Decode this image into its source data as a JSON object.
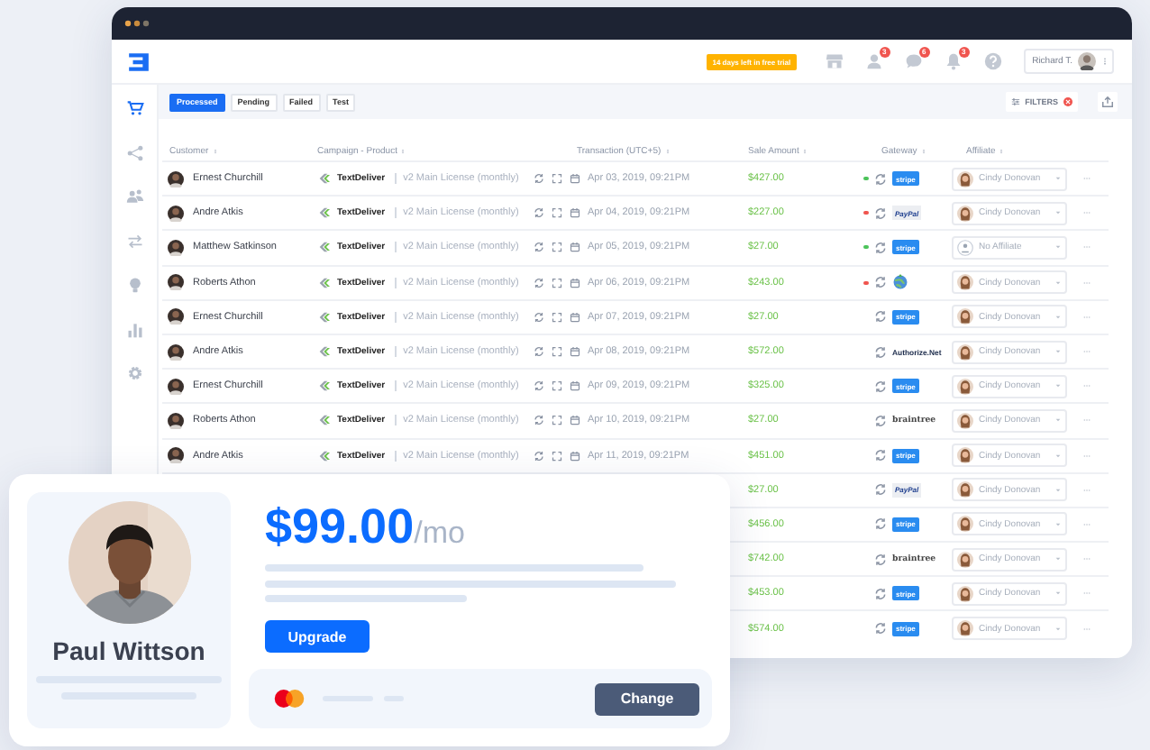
{
  "header": {
    "trial_badge": "14 days left in free trial",
    "icons": [
      {
        "kind": "store"
      },
      {
        "kind": "user",
        "count": "3"
      },
      {
        "kind": "chat",
        "count": "6"
      },
      {
        "kind": "bell",
        "count": "3"
      },
      {
        "kind": "help"
      }
    ],
    "user_name": "Richard T."
  },
  "sidebar": {
    "items": [
      {
        "kind": "cart",
        "selected": true
      },
      {
        "kind": "network",
        "selected": false
      },
      {
        "kind": "users",
        "selected": false
      },
      {
        "kind": "transfer",
        "selected": false
      },
      {
        "kind": "bulb",
        "selected": false
      },
      {
        "kind": "chart",
        "selected": false
      },
      {
        "kind": "settings",
        "selected": false
      }
    ]
  },
  "tabs": [
    {
      "label": "Processed",
      "selected": true
    },
    {
      "label": "Pending",
      "selected": false
    },
    {
      "label": "Failed",
      "selected": false
    },
    {
      "label": "Test",
      "selected": false
    }
  ],
  "filters": {
    "label": "FILTERS"
  },
  "table": {
    "columns": [
      "Customer",
      "Campaign - Product",
      "Transaction (UTC+5)",
      "Sale Amount",
      "Gateway",
      "Affiliate"
    ],
    "rows": [
      {
        "customer": "Ernest Churchill",
        "campaign": "TextDeliver",
        "product": "v2 Main License (monthly)",
        "date": "Apr 03, 2019, 09:21PM",
        "amount": "$427.00",
        "color": "#4cc35a",
        "gateway": {
          "kind": "stripe",
          "label": "stripe"
        },
        "affiliate": {
          "kind": "person",
          "name": "Cindy Donovan"
        }
      },
      {
        "customer": "Andre Atkis",
        "campaign": "TextDeliver",
        "product": "v2 Main License (monthly)",
        "date": "Apr 04, 2019, 09:21PM",
        "amount": "$227.00",
        "color": "#f0554f",
        "gateway": {
          "kind": "paypal",
          "label": "PayPal"
        },
        "affiliate": {
          "kind": "person",
          "name": "Cindy Donovan"
        }
      },
      {
        "customer": "Matthew Satkinson",
        "campaign": "TextDeliver",
        "product": "v2 Main License (monthly)",
        "date": "Apr 05, 2019, 09:21PM",
        "amount": "$27.00",
        "color": "#4cc35a",
        "gateway": {
          "kind": "stripe",
          "label": "stripe"
        },
        "affiliate": {
          "kind": "none",
          "name": "No Affiliate"
        }
      },
      {
        "customer": "Roberts Athon",
        "campaign": "TextDeliver",
        "product": "v2 Main License (monthly)",
        "date": "Apr 06, 2019, 09:21PM",
        "amount": "$243.00",
        "color": "#f0554f",
        "gateway": {
          "kind": "globe"
        },
        "affiliate": {
          "kind": "person",
          "name": "Cindy Donovan"
        }
      },
      {
        "customer": "Ernest Churchill",
        "campaign": "TextDeliver",
        "product": "v2 Main License (monthly)",
        "date": "Apr 07, 2019, 09:21PM",
        "amount": "$27.00",
        "gateway": {
          "kind": "stripe",
          "label": "stripe"
        },
        "affiliate": {
          "kind": "person",
          "name": "Cindy Donovan"
        }
      },
      {
        "customer": "Andre Atkis",
        "campaign": "TextDeliver",
        "product": "v2 Main License (monthly)",
        "date": "Apr 08, 2019, 09:21PM",
        "amount": "$572.00",
        "gateway": {
          "kind": "authorize",
          "label": "Authorize.Net"
        },
        "affiliate": {
          "kind": "person",
          "name": "Cindy Donovan"
        }
      },
      {
        "customer": "Ernest Churchill",
        "campaign": "TextDeliver",
        "product": "v2 Main License (monthly)",
        "date": "Apr 09, 2019, 09:21PM",
        "amount": "$325.00",
        "gateway": {
          "kind": "stripe",
          "label": "stripe"
        },
        "affiliate": {
          "kind": "person",
          "name": "Cindy Donovan"
        }
      },
      {
        "customer": "Roberts Athon",
        "campaign": "TextDeliver",
        "product": "v2 Main License (monthly)",
        "date": "Apr 10, 2019, 09:21PM",
        "amount": "$27.00",
        "gateway": {
          "kind": "braintree",
          "label": "braintree"
        },
        "affiliate": {
          "kind": "person",
          "name": "Cindy Donovan"
        }
      },
      {
        "customer": "Andre Atkis",
        "campaign": "TextDeliver",
        "product": "v2 Main License (monthly)",
        "date": "Apr 11, 2019, 09:21PM",
        "amount": "$451.00",
        "gateway": {
          "kind": "stripe",
          "label": "stripe"
        },
        "affiliate": {
          "kind": "person",
          "name": "Cindy Donovan"
        }
      },
      {
        "amount": "$27.00",
        "gateway": {
          "kind": "paypal",
          "label": "PayPal"
        },
        "affiliate": {
          "kind": "person",
          "name": "Cindy Donovan"
        }
      },
      {
        "amount": "$456.00",
        "gateway": {
          "kind": "stripe",
          "label": "stripe"
        },
        "affiliate": {
          "kind": "person",
          "name": "Cindy Donovan"
        }
      },
      {
        "amount": "$742.00",
        "gateway": {
          "kind": "braintree",
          "label": "braintree"
        },
        "affiliate": {
          "kind": "person",
          "name": "Cindy Donovan"
        }
      },
      {
        "amount": "$453.00",
        "gateway": {
          "kind": "stripe",
          "label": "stripe"
        },
        "affiliate": {
          "kind": "person",
          "name": "Cindy Donovan"
        }
      },
      {
        "amount": "$574.00",
        "gateway": {
          "kind": "stripe",
          "label": "stripe"
        },
        "affiliate": {
          "kind": "person",
          "name": "Cindy Donovan"
        }
      }
    ]
  },
  "plan_card": {
    "name": "Paul Wittson",
    "price": "$99.00",
    "period": "/mo",
    "upgrade": "Upgrade",
    "change": "Change"
  }
}
